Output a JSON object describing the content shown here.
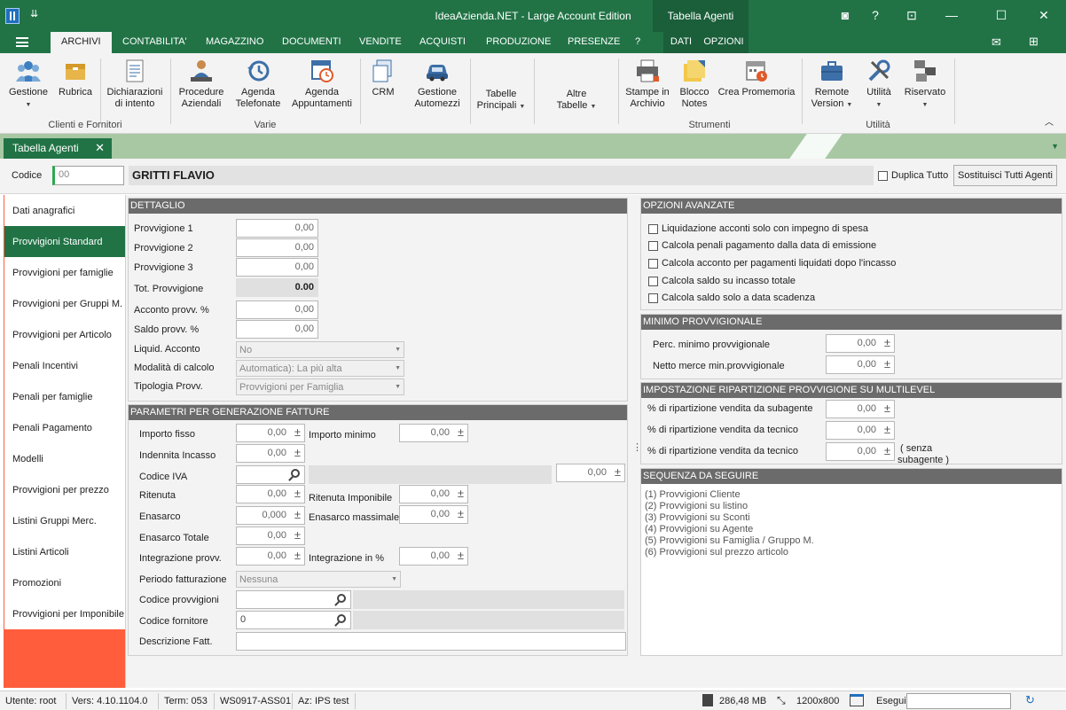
{
  "window": {
    "title": "IdeaAzienda.NET - Large Account Edition",
    "context_tab": "Tabella Agenti",
    "quick_access": "⇊",
    "controls": [
      "◙",
      "?",
      "⊡",
      "—",
      "☐",
      "✕"
    ]
  },
  "menu": {
    "tabs": [
      "ARCHIVI",
      "CONTABILITA'",
      "MAGAZZINO",
      "DOCUMENTI",
      "VENDITE",
      "ACQUISTI",
      "PRODUZIONE",
      "PRESENZE",
      "?",
      "DATI",
      "OPZIONI"
    ],
    "active": "ARCHIVI"
  },
  "ribbon": {
    "buttons": [
      {
        "label": "Gestione",
        "icon": "users-icon"
      },
      {
        "label": "Rubrica",
        "icon": "box-icon"
      },
      {
        "label": "Dichiarazioni\ndi intento",
        "icon": "document-icon"
      },
      {
        "label": "Procedure\nAziendali",
        "icon": "person-desk-icon"
      },
      {
        "label": "Agenda\nTelefonate",
        "icon": "history-icon"
      },
      {
        "label": "Agenda\nAppuntamenti",
        "icon": "calendar-clock-icon"
      },
      {
        "label": "CRM",
        "icon": "copy-icon"
      },
      {
        "label": "Gestione\nAutomezzi",
        "icon": "car-icon"
      },
      {
        "label": "Tabelle\nPrincipali",
        "icon": ""
      },
      {
        "label": "Altre\nTabelle",
        "icon": ""
      },
      {
        "label": "Stampe in\nArchivio",
        "icon": "printer-icon"
      },
      {
        "label": "Blocco\nNotes",
        "icon": "sticky-note-icon"
      },
      {
        "label": "Crea Promemoria",
        "icon": "calendar-alarm-icon"
      },
      {
        "label": "Remote\nVersion",
        "icon": "briefcase-icon"
      },
      {
        "label": "Utilità",
        "icon": "tools-icon"
      },
      {
        "label": "Riservato",
        "icon": "network-icon"
      }
    ],
    "groups": [
      "Clienti e Fornitori",
      "Varie",
      "Strumenti",
      "Utilità"
    ]
  },
  "doc_tab": {
    "label": "Tabella Agenti",
    "close": "✕"
  },
  "header": {
    "codice_label": "Codice",
    "codice_value": "00",
    "name": "GRITTI FLAVIO",
    "duplica_label": "Duplica Tutto",
    "sostituisci_label": "Sostituisci Tutti Agenti"
  },
  "sidebar": {
    "active_index": 1,
    "items": [
      "Dati anagrafici",
      "Provvigioni Standard",
      "Provvigioni per famiglie",
      "Provvigioni per Gruppi M.",
      "Provvigioni per Articolo",
      "Penali Incentivi",
      "Penali per famiglie",
      "Penali Pagamento",
      "Modelli",
      "Provvigioni per prezzo",
      "Listini Gruppi Merc.",
      "Listini Articoli",
      "Promozioni",
      "Provvigioni per Imponibile"
    ]
  },
  "dettaglio": {
    "title": "DETTAGLIO",
    "provv1_label": "Provvigione 1",
    "provv1_value": "0,00",
    "provv2_label": "Provvigione 2",
    "provv2_value": "0,00",
    "provv3_label": "Provvigione 3",
    "provv3_value": "0,00",
    "tot_label": "Tot. Provvigione",
    "tot_value": "0.00",
    "acconto_label": "Acconto provv. %",
    "acconto_value": "0,00",
    "saldo_label": "Saldo provv. %",
    "saldo_value": "0,00",
    "liquid_label": "Liquid. Acconto",
    "liquid_value": "No",
    "modalita_label": "Modalità di calcolo",
    "modalita_value": "Automatica): La più alta",
    "tipologia_label": "Tipologia Provv.",
    "tipologia_value": "Provvigioni per Famiglia"
  },
  "parametri": {
    "title": "PARAMETRI PER GENERAZIONE FATTURE",
    "importo_fisso_label": "Importo fisso",
    "importo_fisso_value": "0,00",
    "importo_minimo_label": "Importo minimo",
    "importo_minimo_value": "0,00",
    "indennita_label": "Indennita Incasso",
    "indennita_value": "0,00",
    "codice_iva_label": "Codice IVA",
    "codice_iva_value": "0,00",
    "ritenuta_label": "Ritenuta",
    "ritenuta_value": "0,00",
    "ritenuta_imp_label": "Ritenuta Imponibile",
    "ritenuta_imp_value": "0,00",
    "enasarco_label": "Enasarco",
    "enasarco_value": "0,000",
    "enasarco_max_label": "Enasarco massimale",
    "enasarco_max_value": "0,00",
    "enasarco_tot_label": "Enasarco Totale",
    "enasarco_tot_value": "0,00",
    "integrazione_label": "Integrazione provv.",
    "integrazione_value": "0,00",
    "integrazione_pct_label": "Integrazione in %",
    "integrazione_pct_value": "0,00",
    "periodo_label": "Periodo fatturazione",
    "periodo_value": "Nessuna",
    "codice_provv_label": "Codice provvigioni",
    "codice_provv_value": "",
    "codice_forn_label": "Codice fornitore",
    "codice_forn_value": "0",
    "descr_label": "Descrizione Fatt.",
    "descr_value": ""
  },
  "opzioni": {
    "title": "OPZIONI AVANZATE",
    "items": [
      "Liquidazione acconti solo con impegno di spesa",
      "Calcola penali pagamento dalla data di emissione",
      "Calcola acconto per pagamenti liquidati dopo l'incasso",
      "Calcola saldo su incasso totale",
      "Calcola saldo solo a data scadenza"
    ]
  },
  "minimo": {
    "title": "MINIMO PROVVIGIONALE",
    "perc_label": "Perc. minimo provvigionale",
    "perc_value": "0,00",
    "netto_label": "Netto merce min.provvigionale",
    "netto_value": "0,00"
  },
  "multilevel": {
    "title": "IMPOSTAZIONE RIPARTIZIONE PROVVIGIONE SU MULTILEVEL",
    "sub_label": "% di ripartizione vendita da subagente",
    "sub_value": "0,00",
    "tec_label": "% di ripartizione vendita da tecnico",
    "tec_value": "0,00",
    "tec2_label": "% di ripartizione vendita da tecnico",
    "tec2_value": "0,00",
    "note_line1": "( senza",
    "note_line2": "subagente )"
  },
  "sequenza": {
    "title": "SEQUENZA DA SEGUIRE",
    "items": [
      "(1) Provvigioni Cliente",
      "(2) Provvigioni su listino",
      "(3) Provvigioni su Sconti",
      "(4) Provvigioni su Agente",
      "(5) Provvigioni su Famiglia / Gruppo M.",
      "(6) Provvigioni sul prezzo articolo"
    ]
  },
  "status": {
    "utente": "Utente: root",
    "versione": "Vers: 4.10.1104.0",
    "term": "Term: 053",
    "ws": "WS0917-ASS01",
    "az": "Az: IPS test",
    "memory": "286,48 MB",
    "resolution": "1200x800",
    "esegui_label": "Esegui"
  }
}
